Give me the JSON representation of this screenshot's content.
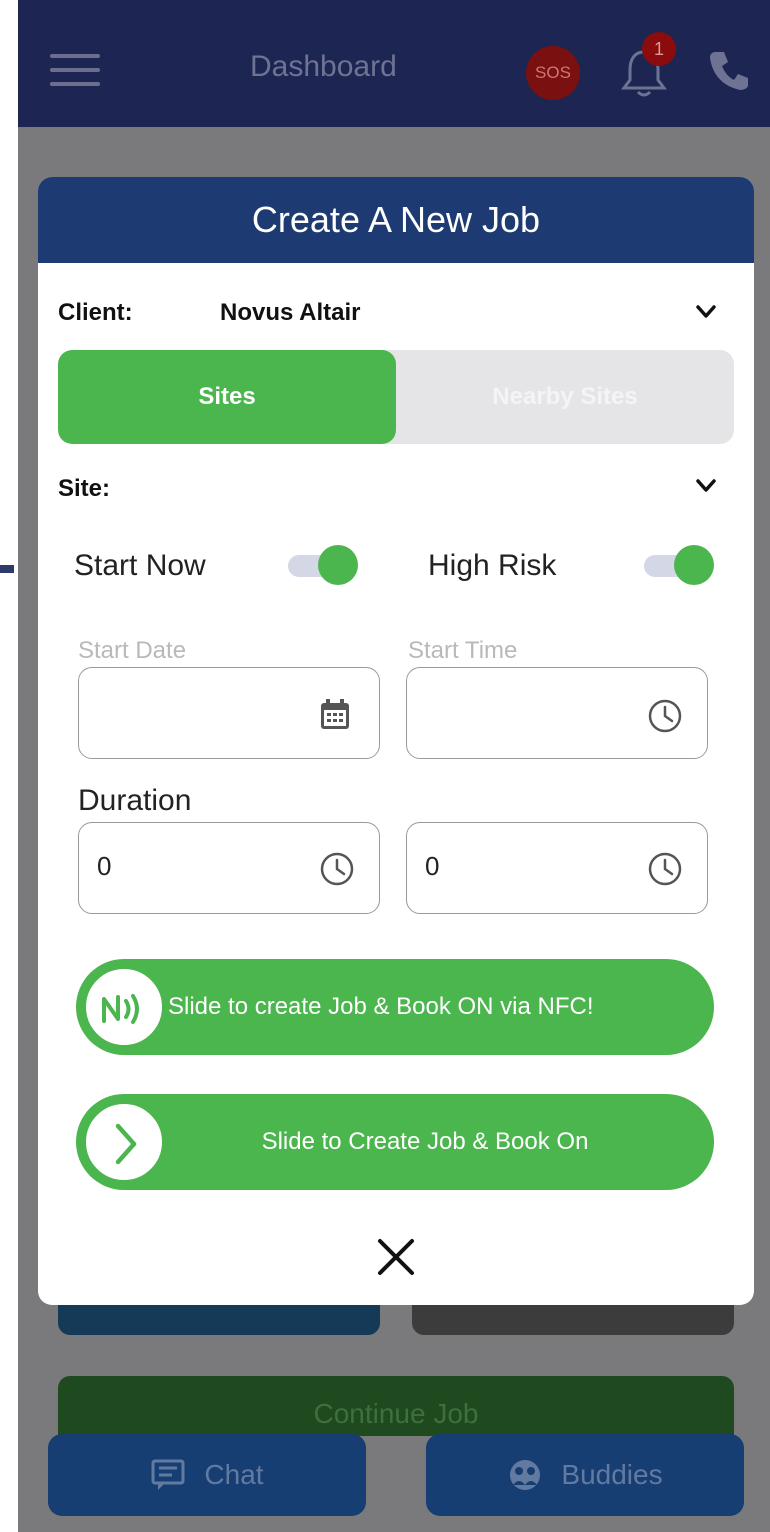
{
  "header": {
    "title": "Dashboard",
    "sos_label": "SOS",
    "notification_count": "1"
  },
  "modal": {
    "title": "Create A New Job",
    "client_label": "Client:",
    "client_value": "Novus Altair",
    "tabs": [
      "Sites",
      "Nearby Sites"
    ],
    "site_label": "Site:",
    "start_now_label": "Start Now",
    "high_risk_label": "High Risk",
    "start_date_label": "Start Date",
    "start_time_label": "Start Time",
    "duration_label": "Duration",
    "duration_hours": "0",
    "duration_minutes": "0",
    "nfc_slider_text": "Slide to create Job & Book ON via NFC!",
    "book_on_slider_text": "Slide to Create Job & Book On"
  },
  "background": {
    "continue_label": "Continue Job"
  },
  "bottom_nav": {
    "chat_label": "Chat",
    "buddies_label": "Buddies"
  },
  "colors": {
    "primary_navy": "#1d2552",
    "modal_header": "#1e3a72",
    "accent_green": "#4bb54e"
  }
}
